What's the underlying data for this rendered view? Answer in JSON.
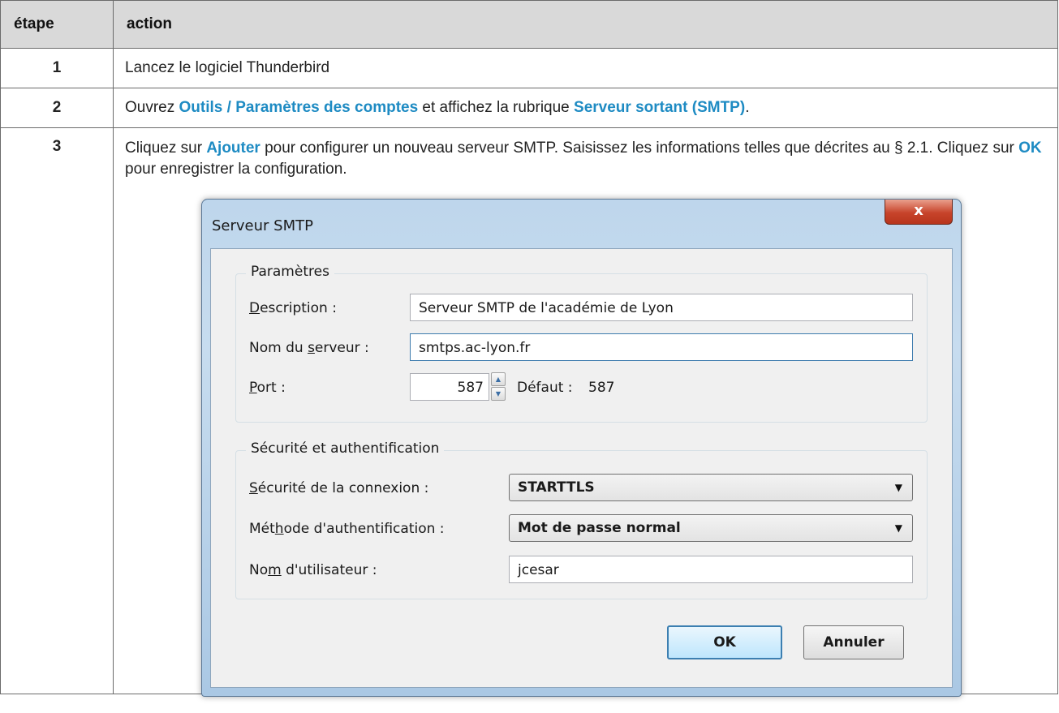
{
  "table": {
    "header": {
      "step": "étape",
      "action": "action"
    },
    "rows": [
      {
        "step": "1",
        "text": "Lancez le logiciel Thunderbird"
      },
      {
        "step": "2",
        "t1": "Ouvrez ",
        "k1": "Outils / Paramètres des comptes",
        "t2": " et affichez la rubrique ",
        "k2": "Serveur sortant (SMTP)",
        "t3": "."
      },
      {
        "step": "3",
        "t1": "Cliquez sur ",
        "k1": "Ajouter",
        "t2": " pour configurer un nouveau serveur SMTP. Saisissez les informations telles que décrites au § 2.1. Cliquez sur ",
        "k2": "OK",
        "t3": " pour enregistrer la configuration."
      }
    ]
  },
  "dialog": {
    "title": "Serveur SMTP",
    "close": "x",
    "params": {
      "legend": "Paramètres",
      "description_label_u": "D",
      "description_label_rest": "escription :",
      "description_value": "Serveur SMTP de l'académie de Lyon",
      "server_label_a": "Nom du ",
      "server_label_u": "s",
      "server_label_b": "erveur :",
      "server_value": "smtps.ac-lyon.fr",
      "port_label_u": "P",
      "port_label_rest": "ort :",
      "port_value": "587",
      "default_label": "Défaut :",
      "default_value": "587"
    },
    "security": {
      "legend": "Sécurité et authentification",
      "conn_label_u": "S",
      "conn_label_rest": "écurité de la connexion :",
      "conn_value": "STARTTLS",
      "auth_label_a": "Mét",
      "auth_label_u": "h",
      "auth_label_b": "ode d'authentification :",
      "auth_value": "Mot de passe normal",
      "user_label_a": "No",
      "user_label_u": "m",
      "user_label_b": " d'utilisateur :",
      "user_value": "jcesar"
    },
    "buttons": {
      "ok": "OK",
      "cancel": "Annuler"
    }
  }
}
